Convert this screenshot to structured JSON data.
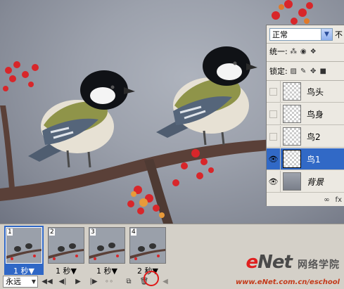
{
  "layers_panel": {
    "blend_mode": "正常",
    "opacity_label": "不",
    "unify_label": "统一:",
    "lock_label": "锁定:",
    "footer_icons": [
      "link-icon",
      "fx-icon"
    ],
    "fx_label": "fx",
    "layers": [
      {
        "name": "鸟头",
        "visible": false,
        "selected": false
      },
      {
        "name": "鸟身",
        "visible": false,
        "selected": false
      },
      {
        "name": "鸟2",
        "visible": false,
        "selected": false
      },
      {
        "name": "鸟1",
        "visible": true,
        "selected": true
      },
      {
        "name": "背景",
        "visible": true,
        "selected": false
      }
    ]
  },
  "animation_panel": {
    "frames": [
      {
        "number": "1",
        "delay": "1 秒▼",
        "selected": true
      },
      {
        "number": "2",
        "delay": "1 秒▼",
        "selected": false
      },
      {
        "number": "3",
        "delay": "1 秒▼",
        "selected": false
      },
      {
        "number": "4",
        "delay": "2 秒▼",
        "selected": false
      }
    ],
    "loop_option": "永远",
    "controls": [
      "first-frame-icon",
      "prev-frame-icon",
      "play-icon",
      "next-frame-icon",
      "tween-icon",
      "duplicate-frame-icon",
      "delete-frame-icon"
    ]
  },
  "watermark": {
    "brand_e": "e",
    "brand_rest": "Net",
    "brand_cn": "网络学院",
    "url": "www.eNet.com.cn/eschool"
  },
  "colors": {
    "selection": "#3169c6",
    "highlight_circle": "#e01818",
    "panel_bg": "#d4d0c8"
  }
}
